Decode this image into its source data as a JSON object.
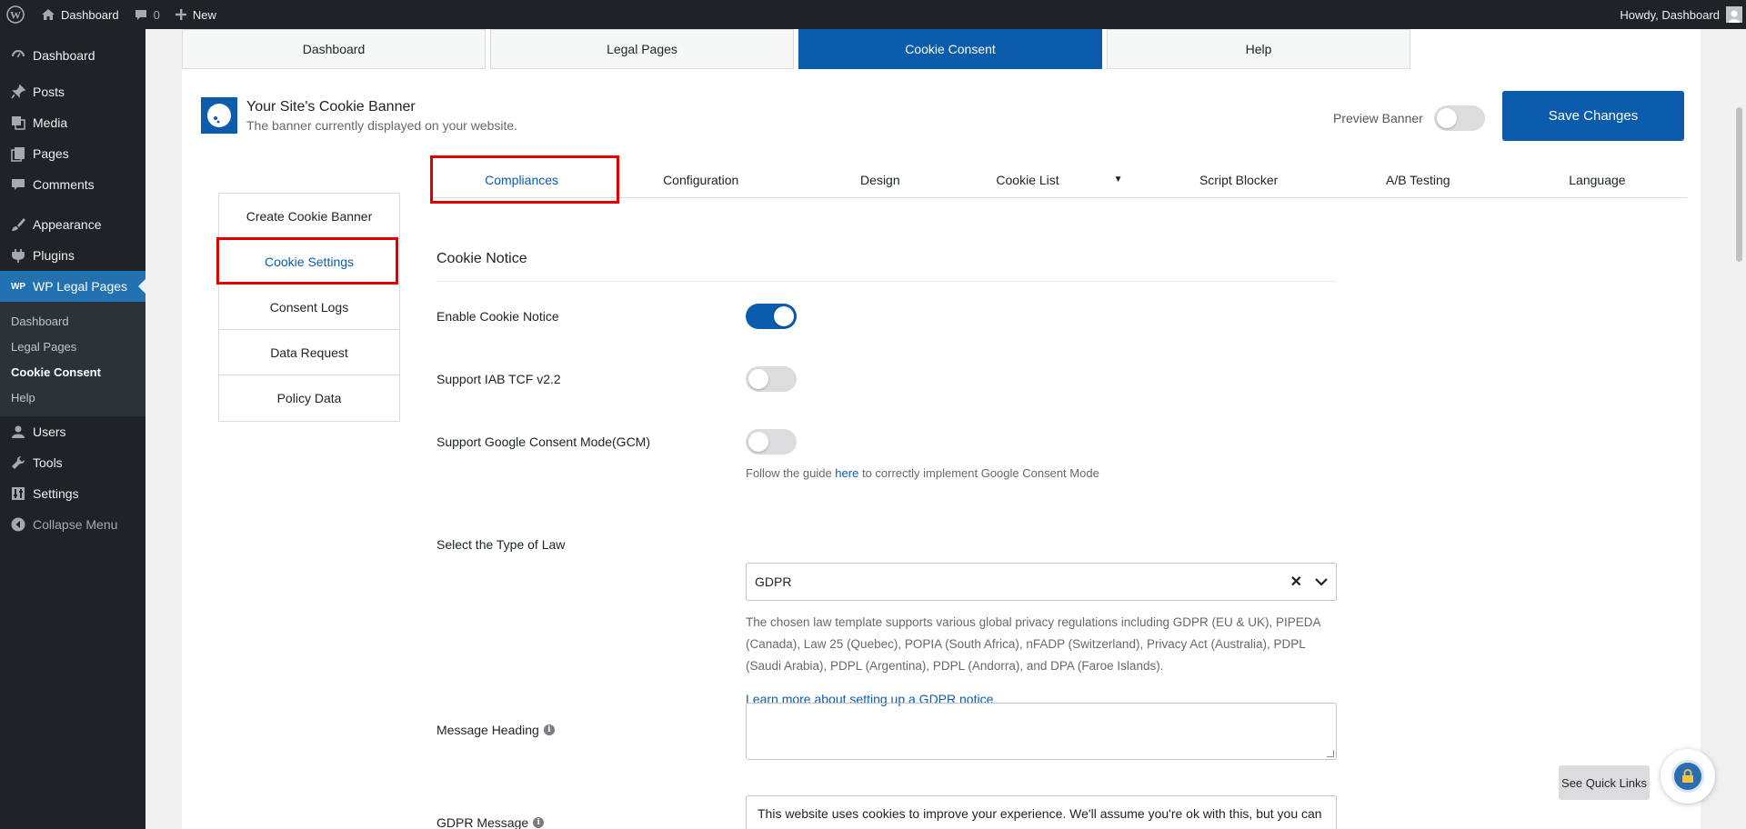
{
  "adminbar": {
    "site_label": "Dashboard",
    "comments_count": "0",
    "new_label": "New",
    "greeting": "Howdy, Dashboard"
  },
  "sidebar": {
    "items": [
      {
        "label": "Dashboard",
        "icon": "dashboard-icon"
      },
      {
        "label": "Posts",
        "icon": "pin-icon"
      },
      {
        "label": "Media",
        "icon": "media-icon"
      },
      {
        "label": "Pages",
        "icon": "pages-icon"
      },
      {
        "label": "Comments",
        "icon": "comment-icon"
      },
      {
        "label": "Appearance",
        "icon": "brush-icon"
      },
      {
        "label": "Plugins",
        "icon": "plug-icon"
      },
      {
        "label": "WP Legal Pages",
        "icon": "wplp-icon"
      },
      {
        "label": "Users",
        "icon": "user-icon"
      },
      {
        "label": "Tools",
        "icon": "wrench-icon"
      },
      {
        "label": "Settings",
        "icon": "settings-icon"
      },
      {
        "label": "Collapse Menu",
        "icon": "collapse-icon"
      }
    ],
    "submenu": [
      "Dashboard",
      "Legal Pages",
      "Cookie Consent",
      "Help"
    ],
    "wplp_icon_text": "WP"
  },
  "top_tabs": [
    "Dashboard",
    "Legal Pages",
    "Cookie Consent",
    "Help"
  ],
  "banner": {
    "title": "Your Site's Cookie Banner",
    "subtitle": "The banner currently displayed on your website.",
    "preview_label": "Preview Banner",
    "save_label": "Save Changes"
  },
  "subnav": [
    "Create Cookie Banner",
    "Cookie Settings",
    "Consent Logs",
    "Data Request",
    "Policy Data"
  ],
  "section_tabs": [
    "Compliances",
    "Configuration",
    "Design",
    "Cookie List",
    "Script Blocker",
    "A/B Testing",
    "Language"
  ],
  "form": {
    "section_title": "Cookie Notice",
    "enable_notice_label": "Enable Cookie Notice",
    "enable_notice_on": true,
    "iab_label": "Support IAB TCF v2.2",
    "iab_on": false,
    "gcm_label": "Support Google Consent Mode(GCM)",
    "gcm_on": false,
    "gcm_help_before": "Follow the guide",
    "gcm_help_link": "here",
    "gcm_help_after": "to correctly implement Google Consent Mode",
    "law_label": "Select the Type of Law",
    "law_value": "GDPR",
    "law_description": "The chosen law template supports various global privacy regulations including GDPR (EU & UK), PIPEDA (Canada), Law 25 (Quebec), POPIA (South Africa), nFADP (Switzerland), Privacy Act (Australia), PDPL (Saudi Arabia), PDPL (Argentina), PDPL (Andorra), and DPA (Faroe Islands).",
    "learn_more": "Learn more about setting up a GDPR notice",
    "message_heading_label": "Message Heading",
    "message_heading_value": "",
    "gdpr_message_label": "GDPR Message",
    "gdpr_message_value": "This website uses cookies to improve your experience. We'll assume you're ok with this, but you can"
  },
  "quick_links_label": "See Quick Links",
  "colors": {
    "accent": "#0b5cad",
    "admin_bg": "#1d2327",
    "highlight": "#e00000"
  }
}
